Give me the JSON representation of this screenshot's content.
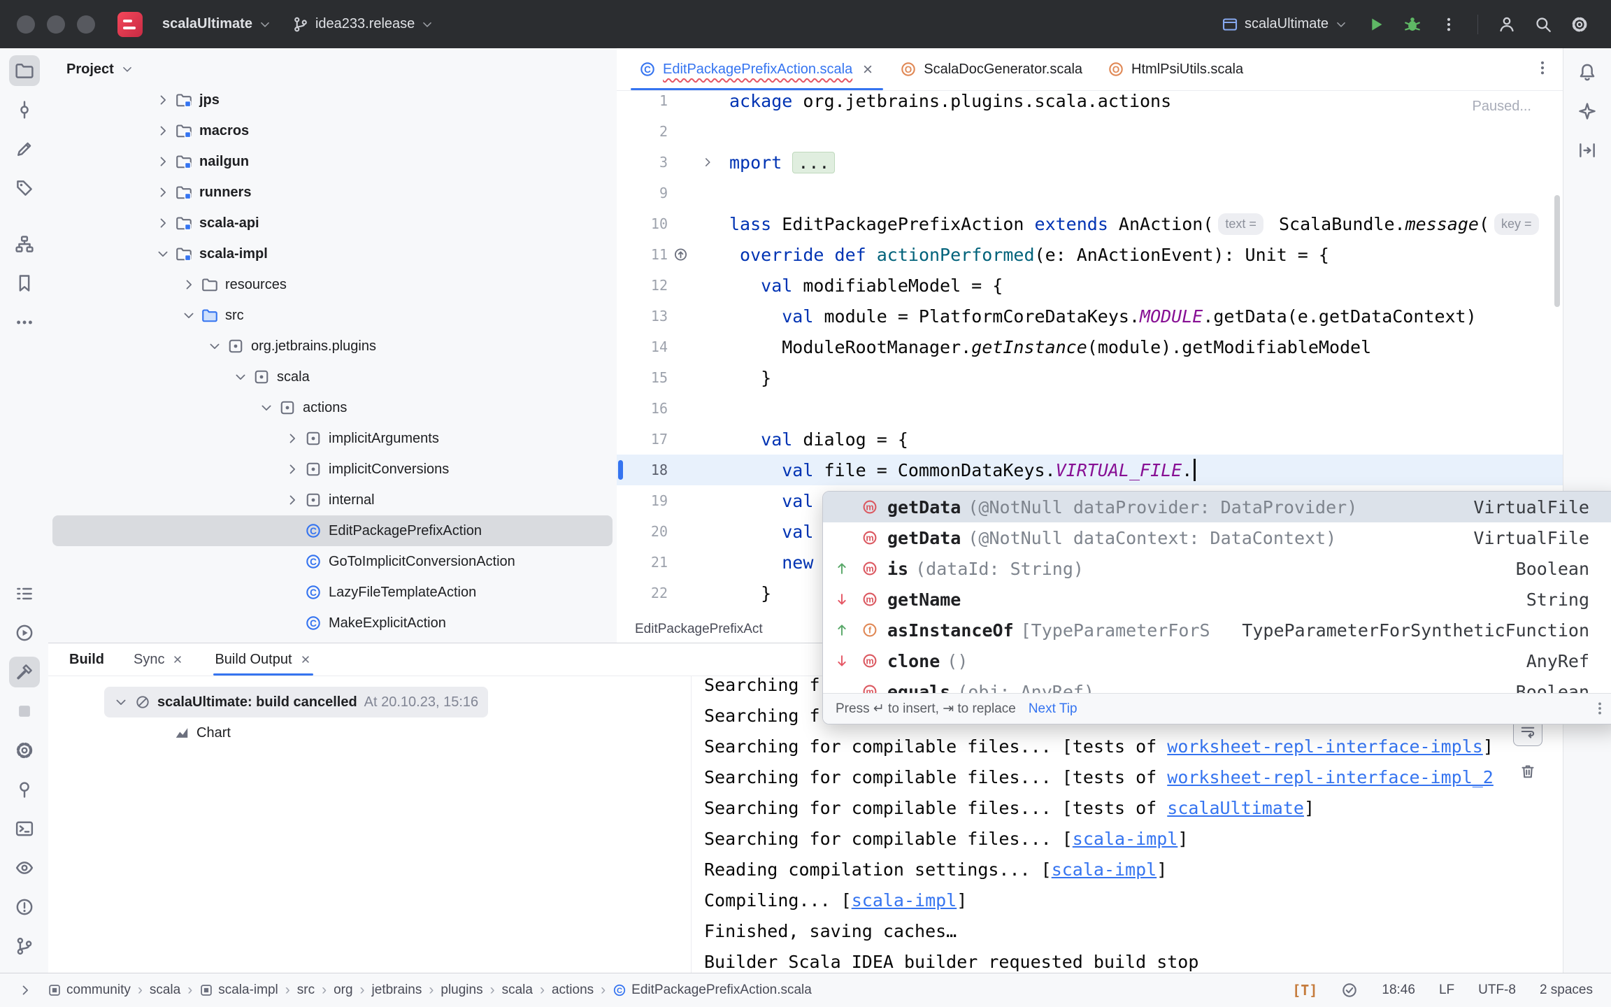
{
  "titlebar": {
    "project": "scalaUltimate",
    "branch": "idea233.release",
    "run_config": "scalaUltimate"
  },
  "left_rail": {
    "top": [
      {
        "icon": "folder",
        "name": "project",
        "active": true
      },
      {
        "icon": "commit",
        "name": "commit"
      },
      {
        "icon": "pencil",
        "name": "edit"
      },
      {
        "icon": "tag",
        "name": "tags"
      },
      {
        "icon": "structure",
        "name": "structure",
        "gap": true
      },
      {
        "icon": "bookmark",
        "name": "bookmarks"
      },
      {
        "icon": "more-h",
        "name": "more"
      }
    ],
    "bottom": [
      {
        "icon": "todo-list",
        "name": "todo"
      },
      {
        "icon": "run-circle",
        "name": "services"
      },
      {
        "icon": "hammer",
        "name": "build",
        "active": true
      },
      {
        "icon": "square",
        "name": "profiler"
      },
      {
        "icon": "gear",
        "name": "settings-sync"
      },
      {
        "icon": "pin",
        "name": "pin"
      },
      {
        "icon": "terminal",
        "name": "terminal"
      },
      {
        "icon": "eye",
        "name": "inspections"
      },
      {
        "icon": "problems",
        "name": "problems"
      },
      {
        "icon": "branch",
        "name": "version-control"
      }
    ]
  },
  "right_rail": [
    {
      "icon": "bell",
      "name": "notifications"
    },
    {
      "icon": "ai",
      "name": "ai-assistant"
    },
    {
      "icon": "columns",
      "name": "diff-viewer"
    }
  ],
  "project": {
    "header": "Project",
    "tree": [
      {
        "d": 2,
        "chev": "right",
        "icon": "module",
        "label": "jps",
        "bold": true
      },
      {
        "d": 2,
        "chev": "right",
        "icon": "module",
        "label": "macros",
        "bold": true
      },
      {
        "d": 2,
        "chev": "right",
        "icon": "module",
        "label": "nailgun",
        "bold": true
      },
      {
        "d": 2,
        "chev": "right",
        "icon": "module",
        "label": "runners",
        "bold": true
      },
      {
        "d": 2,
        "chev": "right",
        "icon": "module",
        "label": "scala-api",
        "bold": true
      },
      {
        "d": 2,
        "chev": "down",
        "icon": "module",
        "label": "scala-impl",
        "bold": true
      },
      {
        "d": 3,
        "chev": "right",
        "icon": "folder",
        "label": "resources"
      },
      {
        "d": 3,
        "chev": "down",
        "icon": "folder-src",
        "label": "src"
      },
      {
        "d": 4,
        "chev": "down",
        "icon": "package",
        "label": "org.jetbrains.plugins"
      },
      {
        "d": 5,
        "chev": "down",
        "icon": "package",
        "label": "scala"
      },
      {
        "d": 6,
        "chev": "down",
        "icon": "package",
        "label": "actions"
      },
      {
        "d": 7,
        "chev": "right",
        "icon": "package",
        "label": "implicitArguments"
      },
      {
        "d": 7,
        "chev": "right",
        "icon": "package",
        "label": "implicitConversions"
      },
      {
        "d": 7,
        "chev": "right",
        "icon": "package",
        "label": "internal"
      },
      {
        "d": 7,
        "chev": null,
        "icon": "class",
        "label": "EditPackagePrefixAction",
        "selected": true
      },
      {
        "d": 7,
        "chev": null,
        "icon": "class",
        "label": "GoToImplicitConversionAction"
      },
      {
        "d": 7,
        "chev": null,
        "icon": "class",
        "label": "LazyFileTemplateAction"
      },
      {
        "d": 7,
        "chev": null,
        "icon": "class",
        "label": "MakeExplicitAction"
      }
    ]
  },
  "editor": {
    "tabs": [
      {
        "label": "EditPackagePrefixAction.scala",
        "icon": "class",
        "active": true,
        "modified": true,
        "has_error": true,
        "closable": true
      },
      {
        "label": "ScalaDocGenerator.scala",
        "icon": "object"
      },
      {
        "label": "HtmlPsiUtils.scala",
        "icon": "object"
      }
    ],
    "paused": "Paused...",
    "breadcrumb": "EditPackagePrefixAct",
    "lines": [
      {
        "n": "1",
        "segs": [
          {
            "c": "k",
            "t": "ackage"
          },
          {
            "c": "p",
            "t": " org.jetbrains.plugins.scala.actions"
          }
        ]
      },
      {
        "n": "2",
        "segs": []
      },
      {
        "n": "3",
        "fold": true,
        "segs": [
          {
            "c": "k",
            "t": "mport"
          },
          {
            "c": "p",
            "t": " "
          },
          {
            "c": "f",
            "t": "..."
          }
        ]
      },
      {
        "n": "9",
        "segs": []
      },
      {
        "n": "10",
        "segs": [
          {
            "c": "k",
            "t": "lass"
          },
          {
            "c": "p",
            "t": " EditPackagePrefixAction "
          },
          {
            "c": "k",
            "t": "extends"
          },
          {
            "c": "p",
            "t": " AnAction("
          },
          {
            "c": "h",
            "t": "text ="
          },
          {
            "c": "p",
            "t": " ScalaBundle."
          },
          {
            "c": "si",
            "t": "message"
          },
          {
            "c": "p",
            "t": "("
          },
          {
            "c": "h",
            "t": "key ="
          }
        ]
      },
      {
        "n": "11",
        "override": true,
        "segs": [
          {
            "c": "k",
            "t": " override def"
          },
          {
            "c": "p",
            "t": " "
          },
          {
            "c": "m",
            "t": "actionPerformed"
          },
          {
            "c": "p",
            "t": "(e: AnActionEvent): Unit = {"
          }
        ]
      },
      {
        "n": "12",
        "segs": [
          {
            "c": "k",
            "t": "   val"
          },
          {
            "c": "p",
            "t": " modifiableModel = {"
          }
        ]
      },
      {
        "n": "13",
        "segs": [
          {
            "c": "k",
            "t": "     val"
          },
          {
            "c": "p",
            "t": " module = PlatformCoreDataKeys."
          },
          {
            "c": "s",
            "t": "MODULE"
          },
          {
            "c": "p",
            "t": ".getData(e.getDataContext)"
          }
        ]
      },
      {
        "n": "14",
        "segs": [
          {
            "c": "p",
            "t": "     ModuleRootManager."
          },
          {
            "c": "si",
            "t": "getInstance"
          },
          {
            "c": "p",
            "t": "(module).getModifiableModel"
          }
        ]
      },
      {
        "n": "15",
        "segs": [
          {
            "c": "p",
            "t": "   }"
          }
        ]
      },
      {
        "n": "16",
        "segs": []
      },
      {
        "n": "17",
        "segs": [
          {
            "c": "k",
            "t": "   val"
          },
          {
            "c": "p",
            "t": " dialog = {"
          }
        ]
      },
      {
        "n": "18",
        "current": true,
        "caret": true,
        "segs": [
          {
            "c": "k",
            "t": "     val"
          },
          {
            "c": "p",
            "t": " file = CommonDataKeys."
          },
          {
            "c": "s",
            "t": "VIRTUAL_FILE"
          },
          {
            "c": "p",
            "t": "."
          }
        ]
      },
      {
        "n": "19",
        "segs": [
          {
            "c": "k",
            "t": "     val"
          }
        ]
      },
      {
        "n": "20",
        "segs": [
          {
            "c": "k",
            "t": "     val"
          }
        ]
      },
      {
        "n": "21",
        "segs": [
          {
            "c": "k",
            "t": "     new"
          }
        ]
      },
      {
        "n": "22",
        "segs": [
          {
            "c": "p",
            "t": "   }"
          }
        ]
      }
    ]
  },
  "completion": {
    "items": [
      {
        "a": "",
        "ic": "m",
        "name": "getData",
        "sig": "(@NotNull dataProvider: DataProvider)",
        "type": "VirtualFile",
        "sel": true
      },
      {
        "a": "",
        "ic": "m",
        "name": "getData",
        "sig": "(@NotNull dataContext: DataContext)",
        "type": "VirtualFile"
      },
      {
        "a": "up",
        "ic": "m",
        "name": "is",
        "sig": "(dataId: String)",
        "type": "Boolean"
      },
      {
        "a": "down",
        "ic": "m",
        "name": "getName",
        "sig": "",
        "type": "String"
      },
      {
        "a": "up",
        "ic": "f",
        "name": "asInstanceOf",
        "sig": "[TypeParameterForS",
        "type": "TypeParameterForSyntheticFunction"
      },
      {
        "a": "down",
        "ic": "m",
        "name": "clone",
        "sig": "()",
        "type": "AnyRef"
      },
      {
        "a": "",
        "ic": "m",
        "name": "equals",
        "sig": "(obj: AnyRef)",
        "type": "Boolean"
      }
    ],
    "footer": {
      "press": "Press ↵ to insert, ⇥ to replace",
      "next_tip": "Next Tip"
    }
  },
  "build": {
    "title": "Build",
    "tabs": [
      {
        "label": "Sync",
        "closable": true
      },
      {
        "label": "Build Output",
        "closable": true,
        "active": true
      }
    ],
    "tree": [
      {
        "label": "scalaUltimate: build cancelled",
        "suffix": "At 20.10.23, 15:16",
        "icon": "cancelled",
        "chevron": true,
        "selected": true,
        "indent": 80
      },
      {
        "label": "Chart",
        "icon": "chart",
        "indent": 166
      }
    ]
  },
  "console": {
    "lines": [
      {
        "segs": [
          {
            "c": "p",
            "t": "Searching f"
          }
        ]
      },
      {
        "segs": [
          {
            "c": "p",
            "t": "Searching f"
          }
        ]
      },
      {
        "segs": [
          {
            "c": "p",
            "t": "Searching for compilable files... [tests of "
          },
          {
            "c": "l",
            "t": "worksheet-repl-interface-impls"
          },
          {
            "c": "p",
            "t": "]"
          }
        ]
      },
      {
        "segs": [
          {
            "c": "p",
            "t": "Searching for compilable files... [tests of "
          },
          {
            "c": "l",
            "t": "worksheet-repl-interface-impl_2"
          }
        ]
      },
      {
        "segs": [
          {
            "c": "p",
            "t": "Searching for compilable files... [tests of "
          },
          {
            "c": "l",
            "t": "scalaUltimate"
          },
          {
            "c": "p",
            "t": "]"
          }
        ]
      },
      {
        "segs": [
          {
            "c": "p",
            "t": "Searching for compilable files... ["
          },
          {
            "c": "l",
            "t": "scala-impl"
          },
          {
            "c": "p",
            "t": "]"
          }
        ]
      },
      {
        "segs": [
          {
            "c": "p",
            "t": "Reading compilation settings... ["
          },
          {
            "c": "l",
            "t": "scala-impl"
          },
          {
            "c": "p",
            "t": "]"
          }
        ]
      },
      {
        "segs": [
          {
            "c": "p",
            "t": "Compiling... ["
          },
          {
            "c": "l",
            "t": "scala-impl"
          },
          {
            "c": "p",
            "t": "]"
          }
        ]
      },
      {
        "segs": [
          {
            "c": "p",
            "t": "Finished, saving caches…"
          }
        ]
      },
      {
        "segs": [
          {
            "c": "p",
            "t": "Builder Scala IDEA builder requested build stop"
          }
        ]
      }
    ]
  },
  "statusbar": {
    "breadcrumbs": [
      {
        "label": "community",
        "icon": "module"
      },
      {
        "label": "scala"
      },
      {
        "label": "scala-impl",
        "icon": "module"
      },
      {
        "label": "src"
      },
      {
        "label": "org"
      },
      {
        "label": "jetbrains"
      },
      {
        "label": "plugins"
      },
      {
        "label": "scala"
      },
      {
        "label": "actions"
      },
      {
        "label": "EditPackagePrefixAction.scala",
        "icon": "class"
      }
    ],
    "t_badge": "[T]",
    "caret": "18:46",
    "line_ending": "LF",
    "encoding": "UTF-8",
    "indent": "2 spaces"
  }
}
